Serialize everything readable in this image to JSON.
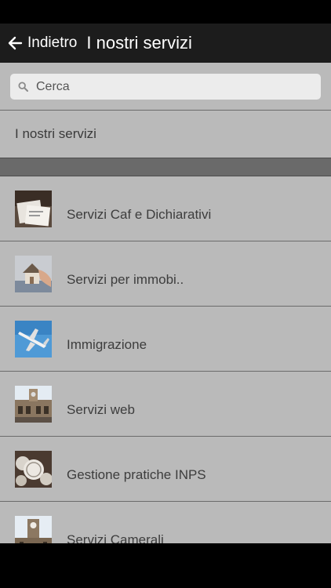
{
  "header": {
    "back_label": "Indietro",
    "title": "I nostri servizi"
  },
  "search": {
    "placeholder": "Cerca"
  },
  "section": {
    "label": "I nostri servizi"
  },
  "services": [
    {
      "label": "Servizi Caf e Dichiarativi",
      "icon": "documents-photo-icon"
    },
    {
      "label": "Servizi per immobi..",
      "icon": "house-model-photo-icon"
    },
    {
      "label": "Immigrazione",
      "icon": "airplane-photo-icon"
    },
    {
      "label": "Servizi web",
      "icon": "building-photo-icon"
    },
    {
      "label": "Gestione pratiche INPS",
      "icon": "coins-photo-icon"
    },
    {
      "label": "Servizi Camerali",
      "icon": "tower-photo-icon"
    }
  ],
  "colors": {
    "header_bg": "#1c1c1c",
    "content_bg": "#bababa",
    "band_bg": "#6a6a6a"
  }
}
